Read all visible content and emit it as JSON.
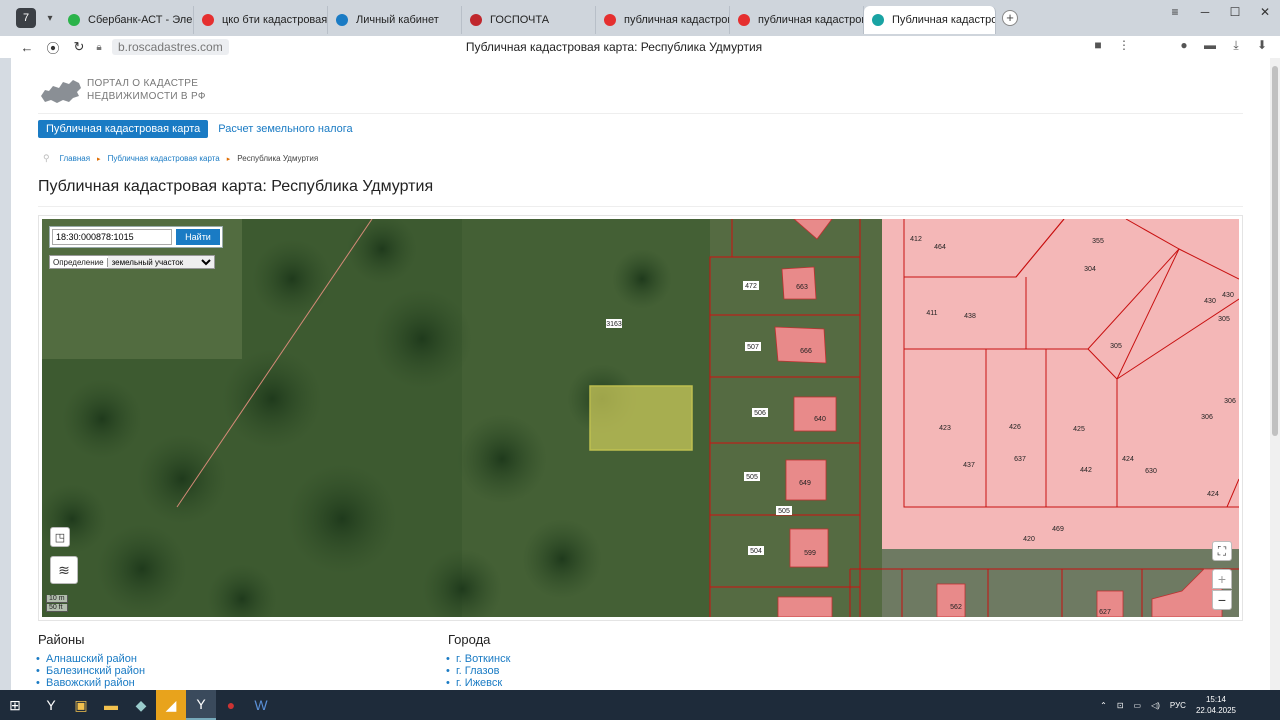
{
  "browser": {
    "tab_count": "7",
    "tabs": [
      {
        "label": "Сбербанк-АСТ - Электро",
        "color": "#2bb34a"
      },
      {
        "label": "цко бти кадастровая сто",
        "color": "#e52f2f"
      },
      {
        "label": "Личный кабинет",
        "color": "#1a7bc4"
      },
      {
        "label": "ГОСПОЧТА",
        "color": "#c0272d"
      },
      {
        "label": "публичная кадастровая к",
        "color": "#e52f2f"
      },
      {
        "label": "публичная кадастровая к",
        "color": "#e52f2f"
      },
      {
        "label": "Публичная кадастровая",
        "color": "#19a3a3",
        "active": true
      }
    ],
    "url": "b.roscadastres.com",
    "page_title": "Публичная кадастровая карта: Республика Удмуртия"
  },
  "site": {
    "logo_line1": "ПОРТАЛ О КАДАСТРЕ",
    "logo_line2": "НЕДВИЖИМОСТИ В РФ",
    "menu_active": "Публичная кадастровая карта",
    "menu_link": "Расчет земельного налога",
    "breadcrumb": [
      "Главная",
      "Публичная кадастровая карта",
      "Республика Удмуртия"
    ],
    "heading": "Публичная кадастровая карта: Республика Удмуртия"
  },
  "map": {
    "search_value": "18:30:000878:1015",
    "search_button": "Найти",
    "definition_label": "Определение",
    "definition_value": "земельный участок",
    "scale_m": "10 m",
    "scale_ft": "50 ft",
    "zoom_in": "+",
    "zoom_out": "−",
    "parcel_labels": [
      "3163",
      "472",
      "663",
      "507",
      "666",
      "506",
      "640",
      "505",
      "649",
      "505",
      "504",
      "599",
      "412",
      "464",
      "355",
      "304",
      "430",
      "430",
      "305",
      "411",
      "438",
      "305",
      "306",
      "306",
      "423",
      "426",
      "425",
      "437",
      "637",
      "442",
      "424",
      "630",
      "424",
      "469",
      "420",
      "562",
      "627"
    ]
  },
  "lists": {
    "districts_title": "Районы",
    "districts": [
      "Алнашский район",
      "Балезинский район",
      "Вавожский район"
    ],
    "cities_title": "Города",
    "cities": [
      "г. Воткинск",
      "г. Глазов",
      "г. Ижевск"
    ]
  },
  "taskbar": {
    "lang": "РУС",
    "time": "15:14",
    "date": "22.04.2025"
  }
}
